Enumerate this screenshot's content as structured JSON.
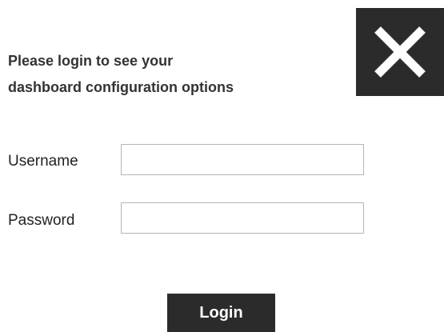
{
  "prompt": {
    "line1": "Please login to see your",
    "line2": "dashboard configuration options"
  },
  "close_button": {
    "icon": "close-icon",
    "background": "#2b2b2b",
    "icon_color": "#ffffff"
  },
  "form": {
    "username_label": "Username",
    "username_value": "",
    "password_label": "Password",
    "password_value": "",
    "login_label": "Login"
  }
}
